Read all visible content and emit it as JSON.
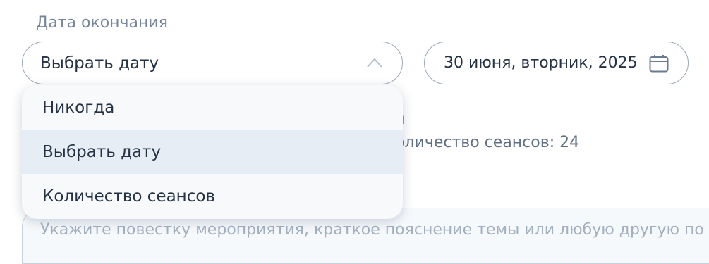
{
  "end_date": {
    "label": "Дата окончания",
    "selected_value": "Выбрать дату",
    "options": [
      "Никогда",
      "Выбрать дату",
      "Количество сеансов"
    ],
    "selected_index": 1
  },
  "date_picker": {
    "value": "30 июня, вторник, 2025",
    "icon": "calendar-icon"
  },
  "background": {
    "partial_line_1": "н",
    "partial_line_2": "оличество сеансов: 24"
  },
  "agenda": {
    "placeholder": "Укажите повестку мероприятия, краткое пояснение темы или любую другую по"
  },
  "colors": {
    "border": "#9aa7b6",
    "selected_option_bg": "#e6edf5",
    "label_text": "#76869a"
  }
}
